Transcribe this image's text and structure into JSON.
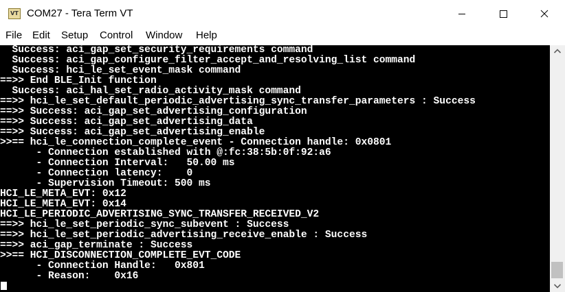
{
  "window": {
    "title": "COM27 - Tera Term VT",
    "icon_label": "VT",
    "controls": [
      "minimize-icon",
      "maximize-icon",
      "close-icon"
    ]
  },
  "menu": {
    "items": [
      "File",
      "Edit",
      "Setup",
      "Control",
      "Window",
      "Help"
    ]
  },
  "terminal": {
    "lines": [
      "  Success: aci_gap_set_security_requirements command",
      "  Success: aci_gap_configure_filter_accept_and_resolving_list command",
      "  Success: hci_le_set_event_mask command",
      "==>> End BLE_Init function",
      "  Success: aci_hal_set_radio_activity_mask command",
      "==>> hci_le_set_default_periodic_advertising_sync_transfer_parameters : Success",
      "==>> Success: aci_gap_set_advertising_configuration",
      "==>> Success: aci_gap_set_advertising_data",
      "==>> Success: aci_gap_set_advertising_enable",
      ">>== hci_le_connection_complete_event - Connection handle: 0x0801",
      "      - Connection established with @:fc:38:5b:0f:92:a6",
      "      - Connection Interval:   50.00 ms",
      "      - Connection latency:    0",
      "      - Supervision Timeout: 500 ms",
      "HCI_LE_META_EVT: 0x12",
      "HCI_LE_META_EVT: 0x14",
      "HCI_LE_PERIODIC_ADVERTISING_SYNC_TRANSFER_RECEIVED_V2",
      "==>> hci_le_set_periodic_sync_subevent : Success",
      "==>> hci_le_set_periodic_advertising_receive_enable : Success",
      "==>> aci_gap_terminate : Success",
      ">>== HCI_DISCONNECTION_COMPLETE_EVT_CODE",
      "      - Connection Handle:   0x801",
      "      - Reason:    0x16"
    ]
  },
  "colors": {
    "terminal_bg": "#000000",
    "terminal_fg": "#ffffff",
    "scrollbar_track": "#f0f0f0",
    "scrollbar_thumb": "#c1c1c1"
  }
}
